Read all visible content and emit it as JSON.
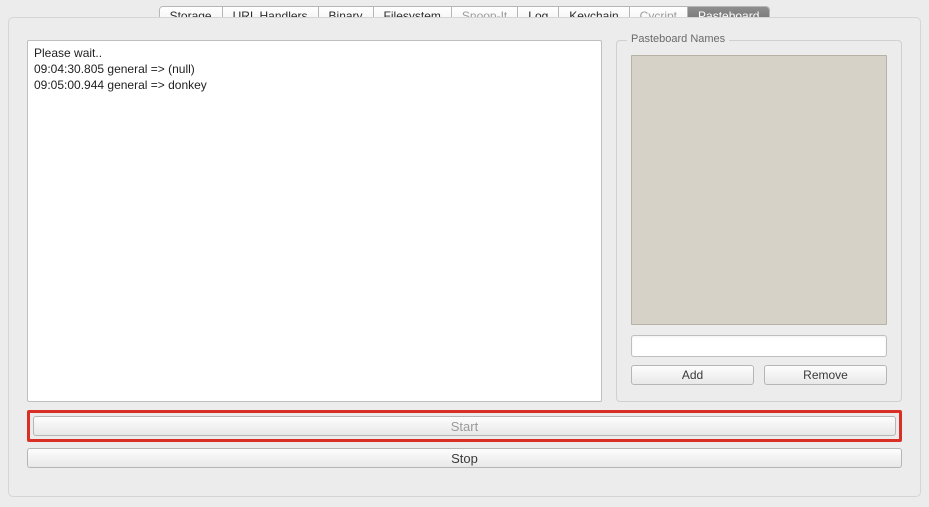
{
  "tabs": [
    {
      "label": "Storage",
      "state": "normal"
    },
    {
      "label": "URL Handlers",
      "state": "normal"
    },
    {
      "label": "Binary",
      "state": "normal"
    },
    {
      "label": "Filesystem",
      "state": "normal"
    },
    {
      "label": "Snoop-It",
      "state": "disabled"
    },
    {
      "label": "Log",
      "state": "normal"
    },
    {
      "label": "Keychain",
      "state": "normal"
    },
    {
      "label": "Cycript",
      "state": "disabled"
    },
    {
      "label": "Pasteboard",
      "state": "active"
    }
  ],
  "log": {
    "line1": "Please wait..",
    "line2": "09:04:30.805 general => (null)",
    "line3": "09:05:00.944 general => donkey"
  },
  "sidebar": {
    "legend": "Pasteboard Names",
    "add_label": "Add",
    "remove_label": "Remove"
  },
  "buttons": {
    "start": "Start",
    "stop": "Stop"
  }
}
